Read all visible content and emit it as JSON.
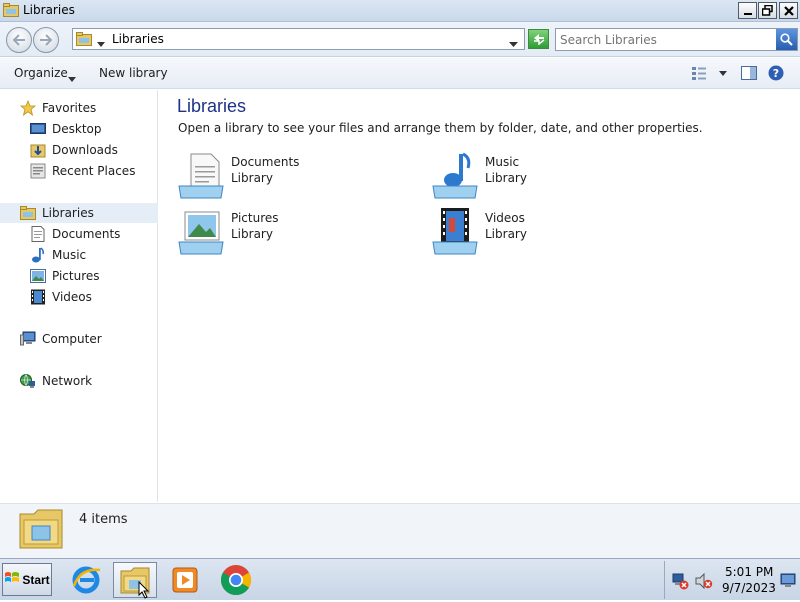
{
  "window": {
    "title": "Libraries",
    "minimize_icon": "minimize-icon",
    "maximize_icon": "restore-icon",
    "close_icon": "close-icon"
  },
  "toolbar": {
    "back_icon": "back-arrow-icon",
    "forward_icon": "forward-arrow-icon",
    "address": "Libraries",
    "search_placeholder": "Search Libraries"
  },
  "commandbar": {
    "organize_label": "Organize",
    "new_library_label": "New library"
  },
  "navpane": {
    "favorites": {
      "label": "Favorites",
      "items": [
        {
          "label": "Desktop"
        },
        {
          "label": "Downloads"
        },
        {
          "label": "Recent Places"
        }
      ]
    },
    "libraries": {
      "label": "Libraries",
      "items": [
        {
          "label": "Documents"
        },
        {
          "label": "Music"
        },
        {
          "label": "Pictures"
        },
        {
          "label": "Videos"
        }
      ]
    },
    "computer": {
      "label": "Computer"
    },
    "network": {
      "label": "Network"
    }
  },
  "content": {
    "heading": "Libraries",
    "subtitle": "Open a library to see your files and arrange them by folder, date, and other properties.",
    "libraries": [
      {
        "name": "Documents",
        "type": "Library",
        "icon": "documents-library-icon"
      },
      {
        "name": "Music",
        "type": "Library",
        "icon": "music-library-icon"
      },
      {
        "name": "Pictures",
        "type": "Library",
        "icon": "pictures-library-icon"
      },
      {
        "name": "Videos",
        "type": "Library",
        "icon": "videos-library-icon"
      }
    ]
  },
  "details": {
    "item_count": "4 items"
  },
  "taskbar": {
    "start_label": "Start",
    "apps": [
      {
        "name": "internet-explorer-icon"
      },
      {
        "name": "windows-explorer-icon",
        "active": true
      },
      {
        "name": "media-player-icon"
      },
      {
        "name": "chrome-icon"
      }
    ],
    "clock": {
      "time": "5:01 PM",
      "date": "9/7/2023"
    }
  }
}
